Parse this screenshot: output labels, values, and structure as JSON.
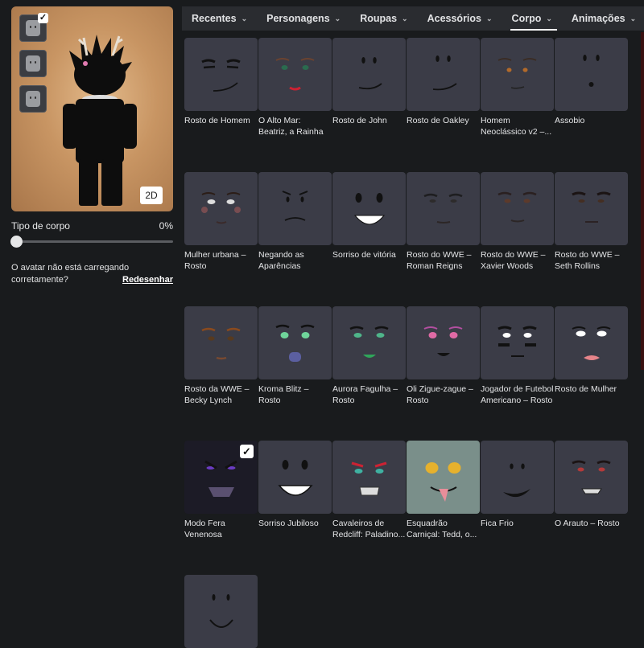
{
  "preview": {
    "button_2d": "2D",
    "check_mark": "✓"
  },
  "body_type": {
    "label": "Tipo de corpo",
    "value": "0%",
    "slider_level": 0
  },
  "loading_notice": {
    "text": "O avatar não está carregando corretamente?",
    "action": "Redesenhar"
  },
  "tabs": [
    {
      "label": "Recentes",
      "active": false
    },
    {
      "label": "Personagens",
      "active": false
    },
    {
      "label": "Roupas",
      "active": false
    },
    {
      "label": "Acessórios",
      "active": false
    },
    {
      "label": "Corpo",
      "active": true
    },
    {
      "label": "Animações",
      "active": false
    }
  ],
  "items": [
    {
      "label": "Rosto de Homem",
      "face": "man"
    },
    {
      "label": "O Alto Mar: Beatriz, a Rainha Pirata –...",
      "face": "pirate"
    },
    {
      "label": "Rosto de John",
      "face": "john"
    },
    {
      "label": "Rosto de Oakley",
      "face": "oakley"
    },
    {
      "label": "Homem Neoclássico v2 –...",
      "face": "neoclassic"
    },
    {
      "label": "Assobio",
      "face": "whistle"
    },
    {
      "label": "Mulher urbana – Rosto",
      "face": "urban"
    },
    {
      "label": "Negando as Aparências",
      "face": "denying"
    },
    {
      "label": "Sorriso de vitória",
      "face": "victory"
    },
    {
      "label": "Rosto do WWE – Roman Reigns",
      "face": "wwe1"
    },
    {
      "label": "Rosto do WWE – Xavier Woods",
      "face": "wwe2"
    },
    {
      "label": "Rosto do WWE – Seth Rollins",
      "face": "wwe3"
    },
    {
      "label": "Rosto da WWE – Becky Lynch",
      "face": "becky"
    },
    {
      "label": "Kroma Blitz – Rosto",
      "face": "kroma"
    },
    {
      "label": "Aurora Fagulha – Rosto",
      "face": "aurora"
    },
    {
      "label": "Oli Zigue-zague – Rosto",
      "face": "oli"
    },
    {
      "label": "Jogador de Futebol Americano – Rosto",
      "face": "football"
    },
    {
      "label": "Rosto de Mulher",
      "face": "woman"
    },
    {
      "label": "Modo Fera Venenosa",
      "face": "beast",
      "selected": true
    },
    {
      "label": "Sorriso Jubiloso",
      "face": "jubilant"
    },
    {
      "label": "Cavaleiros de Redcliff: Paladino...",
      "face": "redcliff"
    },
    {
      "label": "Esquadrão Carniçal: Tedd, o...",
      "face": "ghoul"
    },
    {
      "label": "Fica Frio",
      "face": "chill"
    },
    {
      "label": "O Arauto – Rosto",
      "face": "herald"
    },
    {
      "label": "",
      "face": "smile"
    }
  ],
  "colors": {
    "background": "#191b1d",
    "card": "#3b3c47",
    "tab_bar": "#2a2c30",
    "ghoul_card": "#7a8f8a",
    "beast_card": "#1c1b26"
  }
}
